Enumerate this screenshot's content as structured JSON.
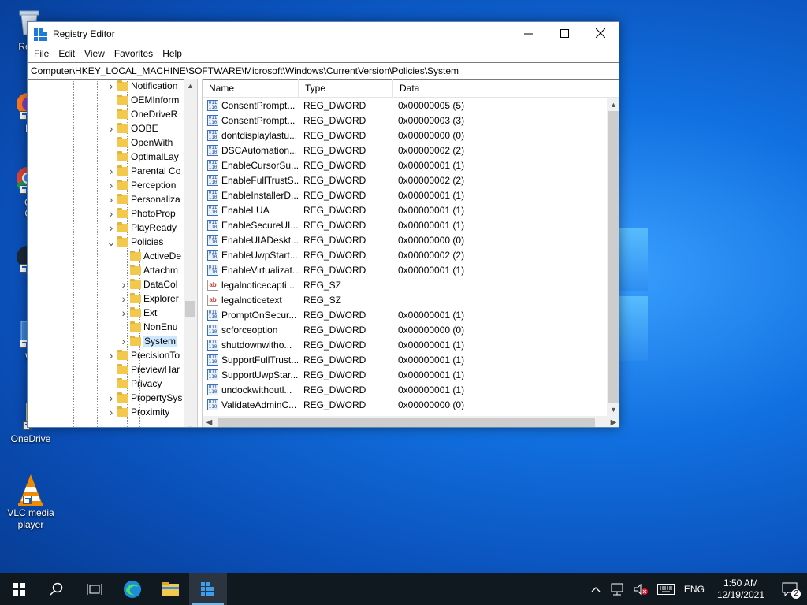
{
  "desktop": {
    "icons": [
      {
        "label": "Recy",
        "name": "recycle-bin"
      },
      {
        "label": "Fir",
        "name": "firefox"
      },
      {
        "label": "Go",
        "label2": "Ch",
        "name": "chrome"
      },
      {
        "label": "St",
        "name": "steam"
      },
      {
        "label": "Wi",
        "name": "windows"
      },
      {
        "label": "OneDrive",
        "name": "onedrive"
      },
      {
        "label": "VLC media player",
        "name": "vlc"
      }
    ]
  },
  "window": {
    "title": "Registry Editor",
    "menu": [
      "File",
      "Edit",
      "View",
      "Favorites",
      "Help"
    ],
    "address": "Computer\\HKEY_LOCAL_MACHINE\\SOFTWARE\\Microsoft\\Windows\\CurrentVersion\\Policies\\System"
  },
  "tree": {
    "items": [
      {
        "label": "Notification",
        "level": 0,
        "expandable": true
      },
      {
        "label": "OEMInform",
        "level": 0,
        "expandable": false
      },
      {
        "label": "OneDriveR",
        "level": 0,
        "expandable": false
      },
      {
        "label": "OOBE",
        "level": 0,
        "expandable": true
      },
      {
        "label": "OpenWith",
        "level": 0,
        "expandable": false
      },
      {
        "label": "OptimalLay",
        "level": 0,
        "expandable": false
      },
      {
        "label": "Parental Co",
        "level": 0,
        "expandable": true
      },
      {
        "label": "Perception",
        "level": 0,
        "expandable": true
      },
      {
        "label": "Personaliza",
        "level": 0,
        "expandable": true
      },
      {
        "label": "PhotoProp",
        "level": 0,
        "expandable": true
      },
      {
        "label": "PlayReady",
        "level": 0,
        "expandable": true
      },
      {
        "label": "Policies",
        "level": 0,
        "expandable": true,
        "expanded": true
      },
      {
        "label": "ActiveDe",
        "level": 1,
        "expandable": false
      },
      {
        "label": "Attachm",
        "level": 1,
        "expandable": false
      },
      {
        "label": "DataCol",
        "level": 1,
        "expandable": true
      },
      {
        "label": "Explorer",
        "level": 1,
        "expandable": true
      },
      {
        "label": "Ext",
        "level": 1,
        "expandable": true
      },
      {
        "label": "NonEnu",
        "level": 1,
        "expandable": false
      },
      {
        "label": "System",
        "level": 1,
        "expandable": true,
        "selected": true
      },
      {
        "label": "PrecisionTo",
        "level": 0,
        "expandable": true
      },
      {
        "label": "PreviewHar",
        "level": 0,
        "expandable": false
      },
      {
        "label": "Privacy",
        "level": 0,
        "expandable": false
      },
      {
        "label": "PropertySys",
        "level": 0,
        "expandable": true
      },
      {
        "label": "Proximity",
        "level": 0,
        "expandable": true
      }
    ]
  },
  "list": {
    "columns": {
      "name": "Name",
      "type": "Type",
      "data": "Data"
    },
    "rows": [
      {
        "name": "ConsentPrompt...",
        "type": "REG_DWORD",
        "data": "0x00000005 (5)",
        "kind": "bin"
      },
      {
        "name": "ConsentPrompt...",
        "type": "REG_DWORD",
        "data": "0x00000003 (3)",
        "kind": "bin"
      },
      {
        "name": "dontdisplaylastu...",
        "type": "REG_DWORD",
        "data": "0x00000000 (0)",
        "kind": "bin"
      },
      {
        "name": "DSCAutomation...",
        "type": "REG_DWORD",
        "data": "0x00000002 (2)",
        "kind": "bin"
      },
      {
        "name": "EnableCursorSu...",
        "type": "REG_DWORD",
        "data": "0x00000001 (1)",
        "kind": "bin"
      },
      {
        "name": "EnableFullTrustS...",
        "type": "REG_DWORD",
        "data": "0x00000002 (2)",
        "kind": "bin"
      },
      {
        "name": "EnableInstallerD...",
        "type": "REG_DWORD",
        "data": "0x00000001 (1)",
        "kind": "bin"
      },
      {
        "name": "EnableLUA",
        "type": "REG_DWORD",
        "data": "0x00000001 (1)",
        "kind": "bin"
      },
      {
        "name": "EnableSecureUI...",
        "type": "REG_DWORD",
        "data": "0x00000001 (1)",
        "kind": "bin"
      },
      {
        "name": "EnableUIADeskt...",
        "type": "REG_DWORD",
        "data": "0x00000000 (0)",
        "kind": "bin"
      },
      {
        "name": "EnableUwpStart...",
        "type": "REG_DWORD",
        "data": "0x00000002 (2)",
        "kind": "bin"
      },
      {
        "name": "EnableVirtualizat...",
        "type": "REG_DWORD",
        "data": "0x00000001 (1)",
        "kind": "bin"
      },
      {
        "name": "legalnoticecapti...",
        "type": "REG_SZ",
        "data": "",
        "kind": "sz"
      },
      {
        "name": "legalnoticetext",
        "type": "REG_SZ",
        "data": "",
        "kind": "sz"
      },
      {
        "name": "PromptOnSecur...",
        "type": "REG_DWORD",
        "data": "0x00000001 (1)",
        "kind": "bin"
      },
      {
        "name": "scforceoption",
        "type": "REG_DWORD",
        "data": "0x00000000 (0)",
        "kind": "bin"
      },
      {
        "name": "shutdownwitho...",
        "type": "REG_DWORD",
        "data": "0x00000001 (1)",
        "kind": "bin"
      },
      {
        "name": "SupportFullTrust...",
        "type": "REG_DWORD",
        "data": "0x00000001 (1)",
        "kind": "bin"
      },
      {
        "name": "SupportUwpStar...",
        "type": "REG_DWORD",
        "data": "0x00000001 (1)",
        "kind": "bin"
      },
      {
        "name": "undockwithoutl...",
        "type": "REG_DWORD",
        "data": "0x00000001 (1)",
        "kind": "bin"
      },
      {
        "name": "ValidateAdminC...",
        "type": "REG_DWORD",
        "data": "0x00000000 (0)",
        "kind": "bin"
      }
    ]
  },
  "taskbar": {
    "language": "ENG",
    "time": "1:50 AM",
    "date": "12/19/2021",
    "notifications": "2"
  },
  "icons": {
    "sz_glyph": "ab",
    "bin_glyph": "011\n110"
  }
}
